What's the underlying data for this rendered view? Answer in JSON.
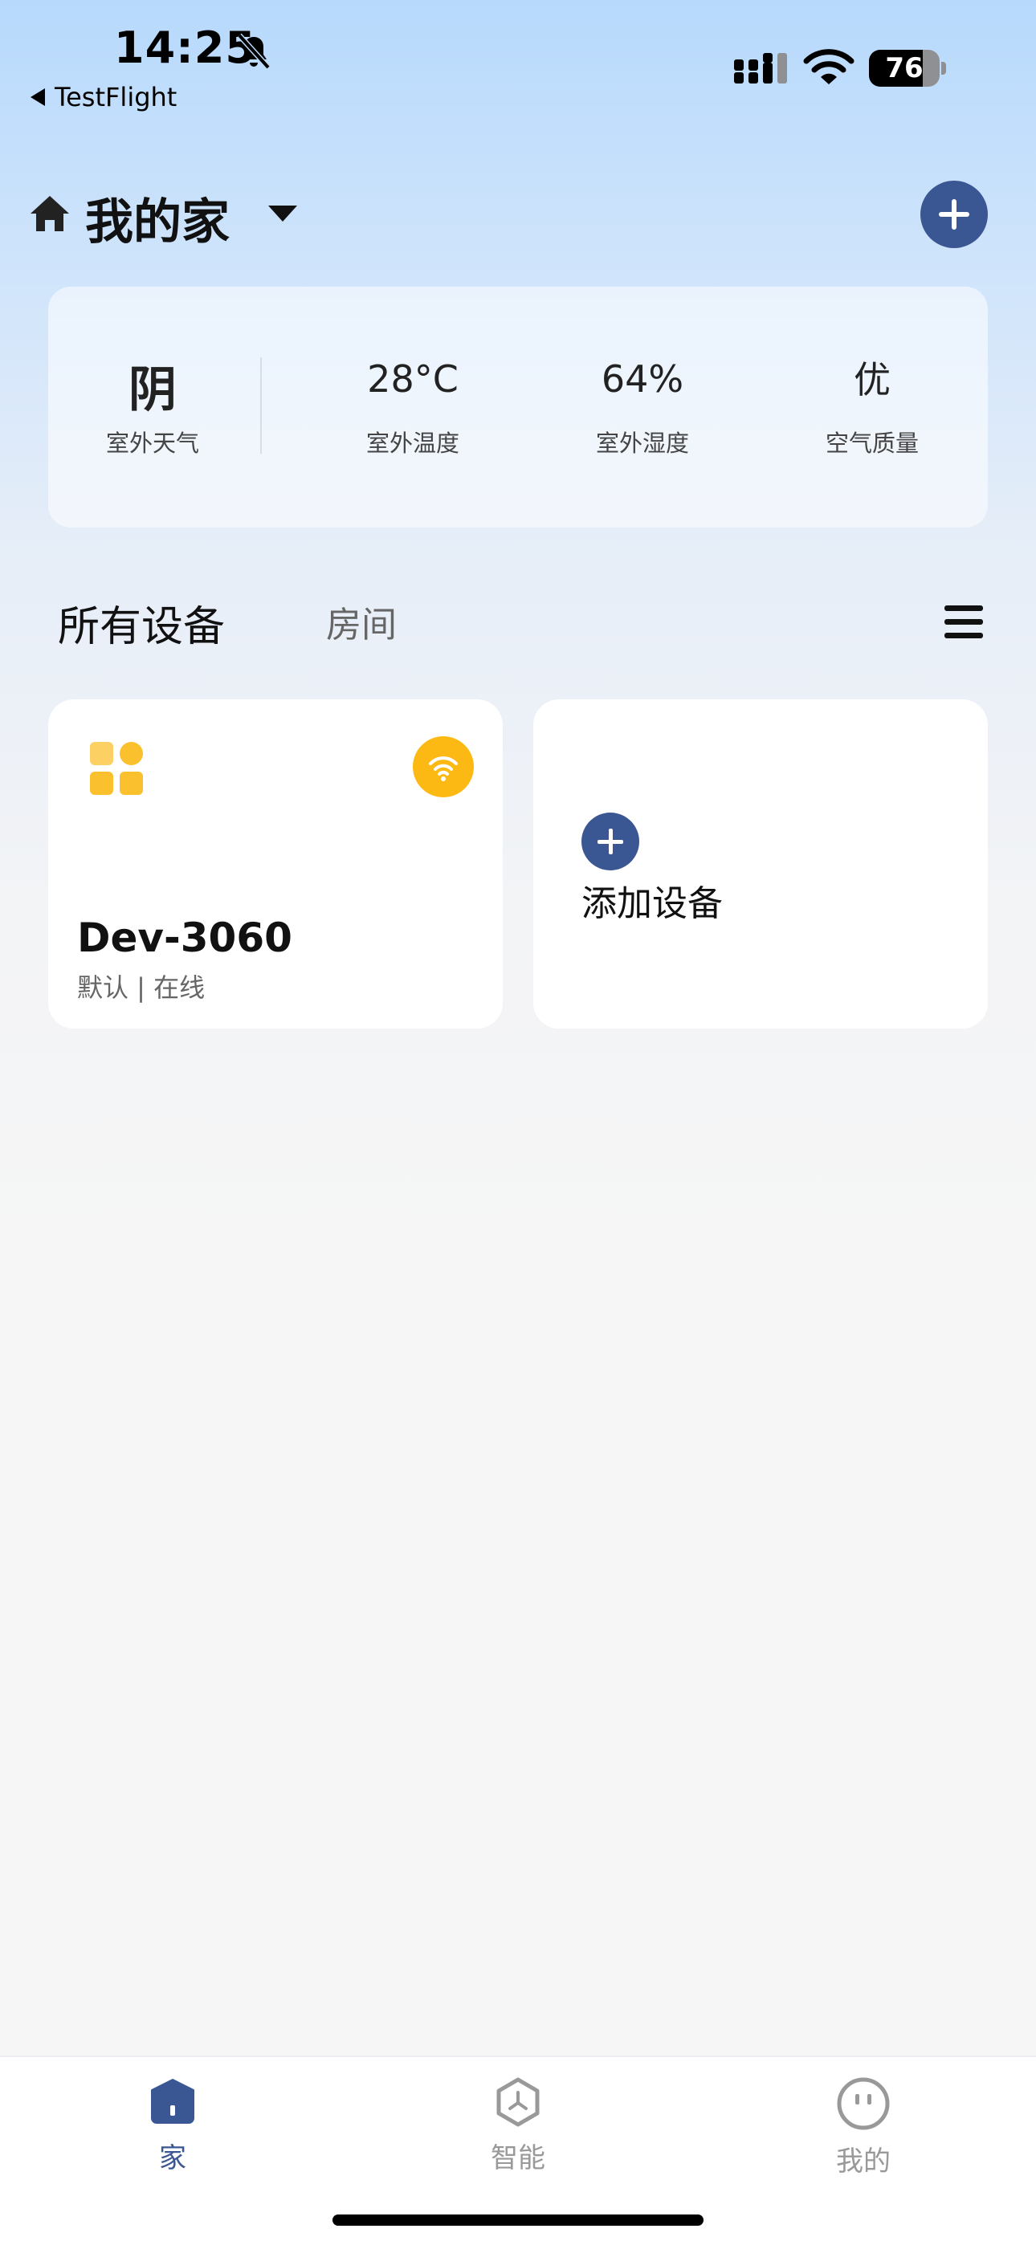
{
  "status_bar": {
    "time": "14:25",
    "back_label": "TestFlight",
    "battery_level": 76,
    "battery_text": "76"
  },
  "header": {
    "home_name": "我的家"
  },
  "weather": {
    "items": [
      {
        "value": "阴",
        "label": "室外天气"
      },
      {
        "value": "28°C",
        "label": "室外温度"
      },
      {
        "value": "64%",
        "label": "室外湿度"
      },
      {
        "value": "优",
        "label": "空气质量"
      }
    ]
  },
  "tabs": {
    "all_devices": "所有设备",
    "rooms": "房间"
  },
  "devices": [
    {
      "name": "Dev-3060",
      "status": "默认 | 在线"
    }
  ],
  "add_device": {
    "label": "添加设备"
  },
  "bottom_nav": {
    "items": [
      {
        "label": "家",
        "active": true
      },
      {
        "label": "智能",
        "active": false
      },
      {
        "label": "我的",
        "active": false
      }
    ]
  },
  "colors": {
    "accent": "#3a5794",
    "device_yellow": "#fdb913",
    "inactive": "#999999"
  }
}
